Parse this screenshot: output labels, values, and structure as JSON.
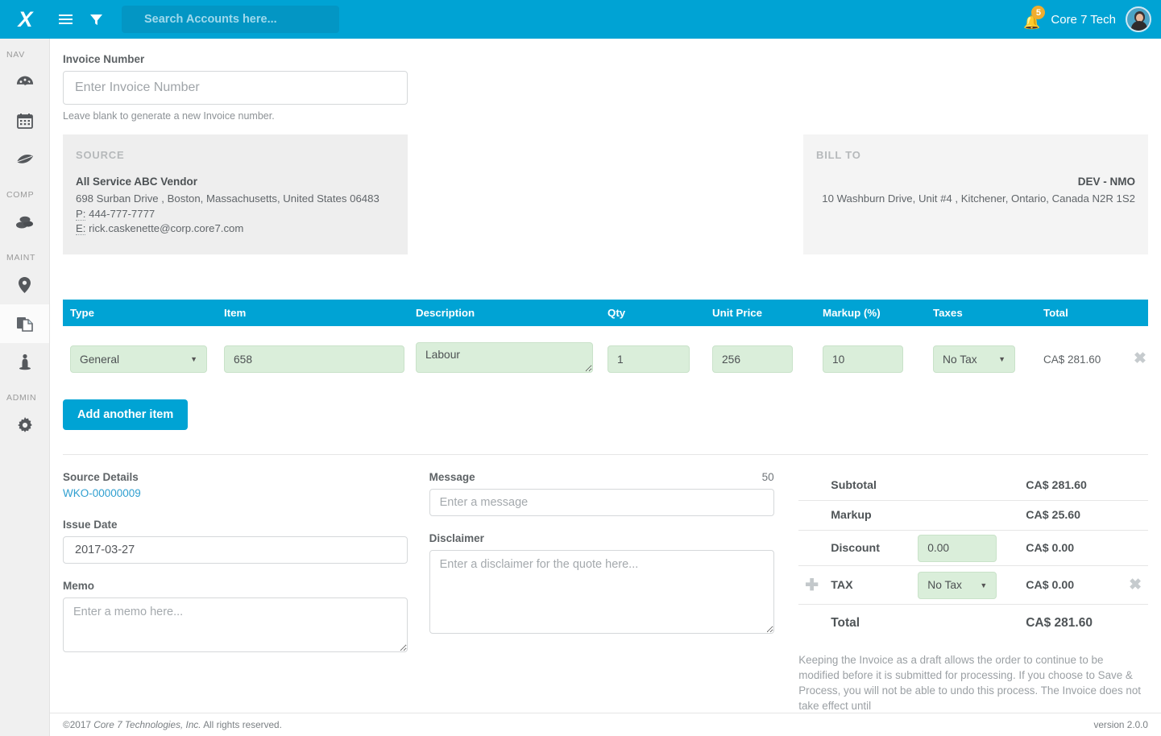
{
  "topbar": {
    "logo": "X",
    "menu_icon": "hamburger-icon",
    "filter_icon": "filter-icon",
    "search_placeholder": "Search Accounts here...",
    "search_value": "",
    "notification_count": "5",
    "username": "Core 7 Tech"
  },
  "sidebar": {
    "groups": [
      {
        "label": "NAV",
        "items": [
          {
            "name": "dashboard",
            "icon": "dashboard-gauge-icon",
            "active": false
          },
          {
            "name": "calendar",
            "icon": "calendar-icon",
            "active": false
          },
          {
            "name": "leaf",
            "icon": "leaf-icon",
            "active": false
          }
        ]
      },
      {
        "label": "COMP",
        "items": [
          {
            "name": "assets",
            "icon": "blocks-icon",
            "active": false
          }
        ]
      },
      {
        "label": "MAINT",
        "items": [
          {
            "name": "locations",
            "icon": "map-pin-icon",
            "active": false
          },
          {
            "name": "documents",
            "icon": "documents-icon",
            "active": true
          },
          {
            "name": "people",
            "icon": "person-icon",
            "active": false
          }
        ]
      },
      {
        "label": "ADMIN",
        "items": [
          {
            "name": "settings",
            "icon": "gear-icon",
            "active": false
          }
        ]
      }
    ]
  },
  "invoice": {
    "number_label": "Invoice Number",
    "number_placeholder": "Enter Invoice Number",
    "number_value": "",
    "number_hint": "Leave blank to generate a new Invoice number."
  },
  "source_panel": {
    "title": "SOURCE",
    "name": "All Service ABC Vendor",
    "address": "698 Surban Drive , Boston, Massachusetts, United States 06483",
    "phone_label": "P:",
    "phone": "444-777-7777",
    "email_label": "E:",
    "email": "rick.caskenette@corp.core7.com"
  },
  "bill_to_panel": {
    "title": "BILL TO",
    "name": "DEV - NMO",
    "address": "10 Washburn Drive, Unit #4 , Kitchener, Ontario, Canada N2R 1S2"
  },
  "items_table": {
    "headers": [
      "Type",
      "Item",
      "Description",
      "Qty",
      "Unit Price",
      "Markup (%)",
      "Taxes",
      "Total"
    ],
    "rows": [
      {
        "type": "General",
        "item": "658",
        "description": "Labour",
        "qty": "1",
        "unit_price": "256",
        "markup": "10",
        "taxes": "No Tax",
        "total": "CA$ 281.60",
        "remove_icon": "close-icon"
      }
    ],
    "add_item_label": "Add another item"
  },
  "source_details": {
    "label": "Source Details",
    "link": "WKO-00000009"
  },
  "issue_date": {
    "label": "Issue Date",
    "value": "2017-03-27"
  },
  "memo": {
    "label": "Memo",
    "placeholder": "Enter a memo here...",
    "value": ""
  },
  "message": {
    "label": "Message",
    "counter": "50",
    "placeholder": "Enter a message",
    "value": ""
  },
  "disclaimer": {
    "label": "Disclaimer",
    "placeholder": "Enter a disclaimer for the quote here...",
    "value": ""
  },
  "totals": {
    "subtotal_label": "Subtotal",
    "subtotal_value": "CA$ 281.60",
    "markup_label": "Markup",
    "markup_value": "CA$ 25.60",
    "discount_label": "Discount",
    "discount_input": "0.00",
    "discount_value": "CA$ 0.00",
    "tax_label": "TAX",
    "tax_select": "No Tax",
    "tax_value": "CA$ 0.00",
    "tax_add_icon": "plus-icon",
    "tax_remove_icon": "close-icon",
    "total_label": "Total",
    "total_value": "CA$ 281.60",
    "note": "Keeping the Invoice as a draft allows the order to continue to be modified before it is submitted for processing. If you choose to Save & Process, you will not be able to undo this process. The Invoice does not take effect until"
  },
  "footer": {
    "copyright_prefix": "©2017 ",
    "company": "Core 7 Technologies, Inc.",
    "copyright_suffix": " All rights reserved.",
    "version": "version 2.0.0"
  },
  "colors": {
    "brand": "#00a3d4",
    "badge": "#f0ad2e",
    "input_green": "#daeeda",
    "link": "#2f9fd0"
  }
}
